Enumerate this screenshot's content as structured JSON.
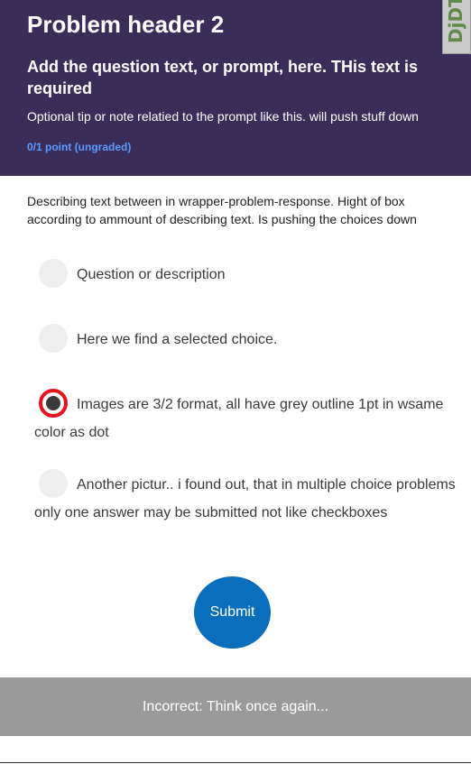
{
  "header": {
    "title": "Problem header 2",
    "prompt": "Add the question text, or prompt, here. THis text is required",
    "tip": "Optional tip or note relatied to the prompt like this. will push stuff down",
    "points": "0/1 point (ungraded)",
    "tab_label": "DjDT"
  },
  "body": {
    "description": "Describing text between in wrapper-problem-response. Hight of box according to ammount of describing text. Is pushing the choices down"
  },
  "choices": [
    {
      "label": "Question or description",
      "selected": false
    },
    {
      "label": "Here we find a selected choice.",
      "selected": false
    },
    {
      "label": "Images are 3/2 format, all have grey outline 1pt in wsame color as dot",
      "selected": true
    },
    {
      "label": "Another pictur.. i found out, that in multiple choice problems only one answer may be submitted not like checkboxes",
      "selected": false
    }
  ],
  "actions": {
    "submit_label": "Submit"
  },
  "feedback": {
    "message": "Incorrect:  Think once again..."
  },
  "colors": {
    "header_bg": "#3b2d5a",
    "points_text": "#5b9bff",
    "submit_bg": "#0b6ebd",
    "selected_ring": "#e8101a",
    "feedback_bg": "#9a9a9a"
  }
}
